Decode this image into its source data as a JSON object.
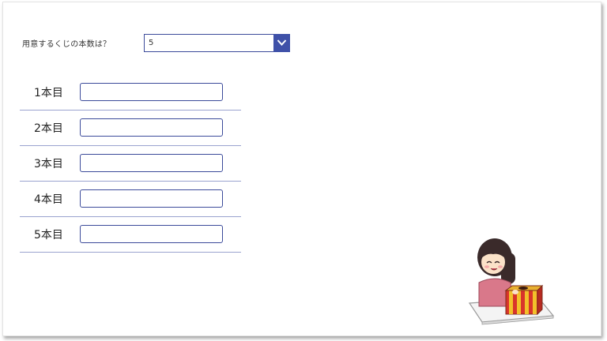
{
  "form": {
    "question_label": "用意するくじの本数は？",
    "count_select": {
      "selected_value": "5"
    }
  },
  "lottery_rows": [
    {
      "label": "1本目",
      "value": ""
    },
    {
      "label": "2本目",
      "value": ""
    },
    {
      "label": "3本目",
      "value": ""
    },
    {
      "label": "4本目",
      "value": ""
    },
    {
      "label": "5本目",
      "value": ""
    }
  ],
  "colors": {
    "accent": "#3f51a8",
    "border": "#3b4a9a",
    "divider": "#9aa3cf"
  },
  "icons": {
    "dropdown": "chevron-down-icon",
    "illustration": "lottery-box-girl-illustration"
  }
}
